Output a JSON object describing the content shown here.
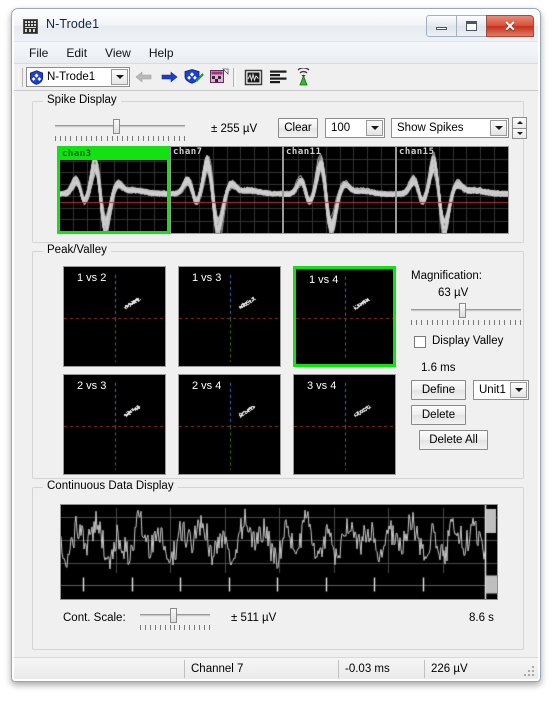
{
  "window": {
    "title": "N-Trode1",
    "icon": "grid-icon",
    "buttons": {
      "minimize": "minimize-icon",
      "maximize": "maximize-icon",
      "close": "✕"
    }
  },
  "menubar": {
    "items": [
      {
        "label": "File"
      },
      {
        "label": "Edit"
      },
      {
        "label": "View"
      },
      {
        "label": "Help"
      }
    ]
  },
  "toolbar": {
    "trode_combo": {
      "value": "N-Trode1",
      "icon": "shield-icon"
    },
    "buttons": [
      {
        "name": "back-arrow-icon",
        "label": ""
      },
      {
        "name": "forward-arrow-icon",
        "label": ""
      },
      {
        "name": "shield-edit-icon",
        "label": ""
      },
      {
        "name": "new-window-icon",
        "label": ""
      },
      {
        "name": "waveform-view-icon",
        "label": ""
      },
      {
        "name": "list-view-icon",
        "label": ""
      },
      {
        "name": "broadcast-icon",
        "label": ""
      }
    ]
  },
  "spike_display": {
    "title": "Spike Display",
    "scale_slider": {
      "value_pct": 47
    },
    "scale_label": "± 255 µV",
    "clear_button": "Clear",
    "count_combo": {
      "value": "100"
    },
    "mode_combo": {
      "value": "Show Spikes"
    },
    "channels": [
      {
        "label": "chan3",
        "selected": true
      },
      {
        "label": "chan7",
        "selected": false
      },
      {
        "label": "chan11",
        "selected": false
      },
      {
        "label": "chan15",
        "selected": false
      }
    ]
  },
  "peak_valley": {
    "title": "Peak/Valley",
    "panels": [
      {
        "label": "1 vs 2",
        "selected": false
      },
      {
        "label": "1 vs 3",
        "selected": false
      },
      {
        "label": "1 vs 4",
        "selected": true
      },
      {
        "label": "2 vs 3",
        "selected": false
      },
      {
        "label": "2 vs 4",
        "selected": false
      },
      {
        "label": "3 vs 4",
        "selected": false
      }
    ],
    "magnification_label": "Magnification:",
    "magnification_value": "63 µV",
    "magnification_slider": {
      "value_pct": 47
    },
    "display_valley": {
      "label": "Display Valley",
      "checked": false
    },
    "time_label": "1.6 ms",
    "define_button": "Define",
    "unit_combo": {
      "value": "Unit1"
    },
    "delete_button": "Delete",
    "delete_all_button": "Delete All"
  },
  "continuous": {
    "title": "Continuous Data Display",
    "scale_label": "Cont. Scale:",
    "scale_slider": {
      "value_pct": 47
    },
    "scale_value": "± 511 µV",
    "time_value": "8.6 s"
  },
  "statusbar": {
    "cells": [
      {
        "name": "status-blank",
        "text": ""
      },
      {
        "name": "status-channel",
        "text": "Channel 7"
      },
      {
        "name": "status-time",
        "text": "-0.03 ms"
      },
      {
        "name": "status-voltage",
        "text": "226 µV"
      }
    ]
  },
  "colors": {
    "selection_green": "#12e212",
    "panel_black": "#000000",
    "waveform_gray": "#cfcfcf",
    "threshold_red": "#c03030",
    "grid_gray": "#3a3a3a",
    "window_bg": "#f0f0f0",
    "close_red": "#c6301c"
  }
}
